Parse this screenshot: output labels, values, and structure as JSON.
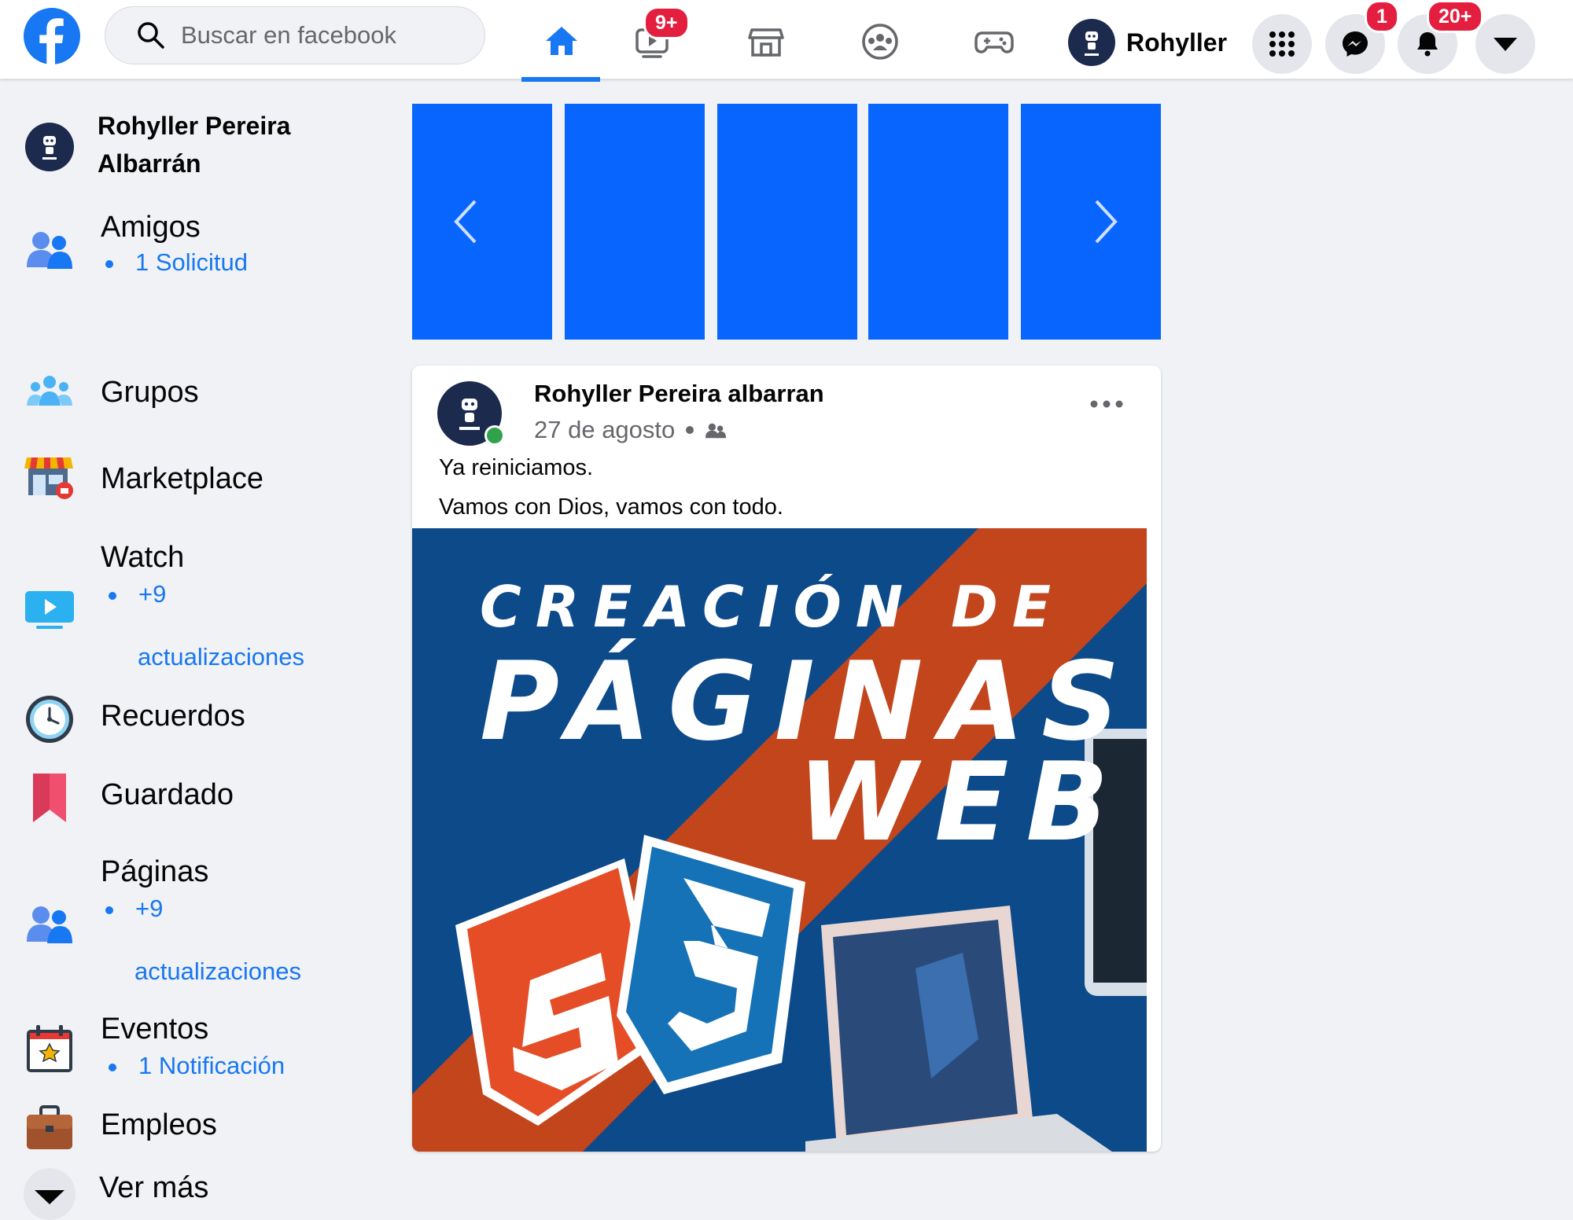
{
  "topbar": {
    "logo_icon": "facebook-logo",
    "search_placeholder": "Buscar en facebook",
    "tabs": [
      {
        "icon": "home-icon",
        "active": true
      },
      {
        "icon": "watch-icon",
        "badge": "9+"
      },
      {
        "icon": "marketplace-icon"
      },
      {
        "icon": "groups-icon"
      },
      {
        "icon": "gaming-icon"
      }
    ],
    "profile_name": "Rohyller",
    "messenger_badge": "1",
    "notifications_badge": "20+"
  },
  "sidebar": {
    "profile_name": "Rohyller Pereira Albarrán",
    "items": [
      {
        "label": "Amigos",
        "sub": "1 Solicitud",
        "icon": "friends-icon"
      },
      {
        "label": "Grupos",
        "icon": "groups-icon"
      },
      {
        "label": "Marketplace",
        "icon": "marketplace-icon"
      },
      {
        "label": "Watch",
        "sub": "+9",
        "sub2": "actualizaciones",
        "icon": "watch-icon"
      },
      {
        "label": "Recuerdos",
        "icon": "memories-icon"
      },
      {
        "label": "Guardado",
        "icon": "saved-icon"
      },
      {
        "label": "Páginas",
        "sub": "+9",
        "sub2": "actualizaciones",
        "icon": "pages-icon"
      },
      {
        "label": "Eventos",
        "sub": "1 Notificación",
        "icon": "events-icon"
      },
      {
        "label": "Empleos",
        "icon": "jobs-icon"
      },
      {
        "label": "Ver más",
        "icon": "chevron-down-icon"
      }
    ]
  },
  "post": {
    "author": "Rohyller Pereira albarran",
    "date": "27 de agosto",
    "text_line1": "Ya reiniciamos.",
    "text_line2": "Vamos con Dios, vamos con todo.",
    "image": {
      "line1": "CREACIÓN DE",
      "line2": "PÁGINAS",
      "line3": "WEB"
    }
  },
  "colors": {
    "accent": "#1877f2",
    "story_blue": "#0866ff",
    "badge_red": "#e41e3f",
    "background": "#f0f2f5"
  }
}
